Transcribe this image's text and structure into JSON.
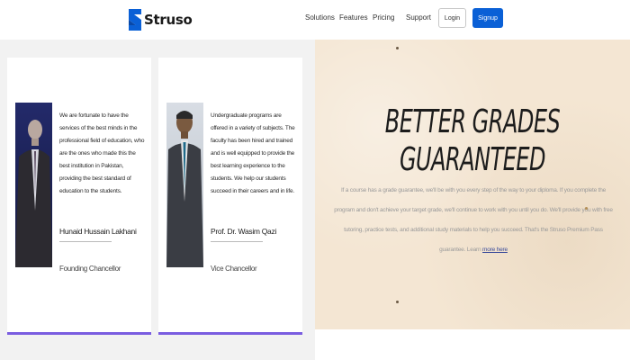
{
  "brand": {
    "name": "Struso",
    "logo_color": "#0a60d6"
  },
  "nav": {
    "items": [
      "Solutions",
      "Features",
      "Pricing",
      "Support"
    ],
    "login_label": "Login",
    "signup_label": "Signup",
    "signup_color": "#0a60d6"
  },
  "testimonials": [
    {
      "quote": "We are fortunate to have the services of the best minds in the professional field of education, who are the ones who made this the best institution in Pakistan, providing the best standard of education to the students.",
      "name": "Hunaid Hussain Lakhani",
      "role": "Founding Chancellor"
    },
    {
      "quote": "Undergraduate programs are offered in a variety of subjects. The faculty has been hired and trained and is well equipped to provide the best learning experience to the students. We help our students succeed in their careers and in life.",
      "name": "Prof. Dr. Wasim Qazi",
      "role": "Vice Chancellor"
    }
  ],
  "accent_bar_color": "#7a5de0",
  "hero": {
    "title": "BETTER GRADES GUARANTEED",
    "body": "If a course has a grade guarantee, we'll be with you every step of the way to your diploma. If you complete the program and don't achieve your target grade, we'll continue to work with you until you do. We'll provide you with free tutoring, practice tests, and additional study materials to help you succeed. That's the Struso Premium Pass guarantee. Learn",
    "link_label": "more here"
  }
}
